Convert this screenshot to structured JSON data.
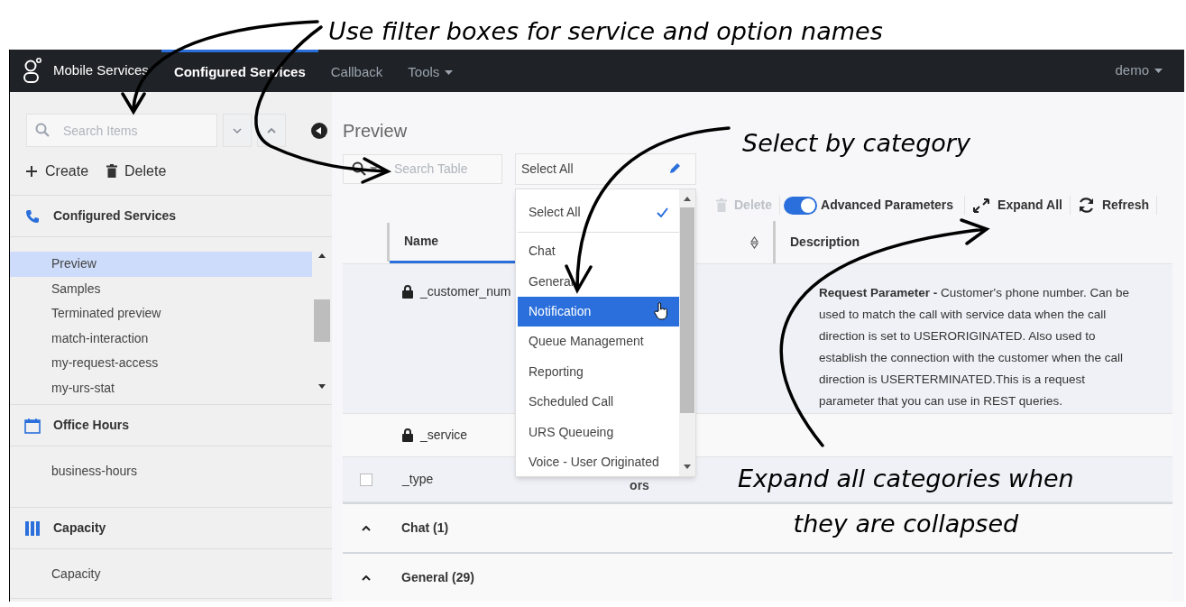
{
  "annotations": [
    {
      "lines": [
        "Use filter boxes for service and option names"
      ]
    },
    {
      "lines": [
        "Select by category"
      ]
    },
    {
      "lines": [
        "Expand all categories when",
        "they are collapsed"
      ]
    }
  ],
  "nav": {
    "brand": "Mobile Services",
    "items": [
      {
        "label": "Configured Services",
        "selected": true,
        "menu": false
      },
      {
        "label": "Callback",
        "selected": false,
        "menu": false
      },
      {
        "label": "Tools",
        "selected": false,
        "menu": true
      }
    ],
    "user": "demo"
  },
  "sidebar": {
    "search": {
      "placeholder": "Search Items"
    },
    "actions": [
      {
        "kind": "create",
        "label": "Create"
      },
      {
        "kind": "delete",
        "label": "Delete"
      }
    ],
    "sections": [
      {
        "title": "Configured Services",
        "items": [
          {
            "label": "Preview",
            "selected": true
          },
          {
            "label": "Samples",
            "selected": false
          },
          {
            "label": "Terminated preview",
            "selected": false
          },
          {
            "label": "match-interaction",
            "selected": false
          },
          {
            "label": "my-request-access",
            "selected": false
          },
          {
            "label": "my-urs-stat",
            "selected": false
          }
        ]
      },
      {
        "title": "Office Hours",
        "items": [
          {
            "label": "business-hours",
            "selected": false
          }
        ]
      },
      {
        "title": "Capacity",
        "items": [
          {
            "label": "Capacity",
            "selected": false
          }
        ]
      }
    ]
  },
  "main": {
    "title": "Preview",
    "table_search": {
      "placeholder": "Search Table"
    },
    "category_select": {
      "value": "Select All",
      "options": [
        {
          "label": "Select All",
          "selected": true,
          "highlighted": false
        },
        {
          "label": "Chat",
          "selected": false,
          "highlighted": false
        },
        {
          "label": "General",
          "selected": false,
          "highlighted": false
        },
        {
          "label": "Notification",
          "selected": false,
          "highlighted": true
        },
        {
          "label": "Queue Management",
          "selected": false,
          "highlighted": false
        },
        {
          "label": "Reporting",
          "selected": false,
          "highlighted": false
        },
        {
          "label": "Scheduled Call",
          "selected": false,
          "highlighted": false
        },
        {
          "label": "URS Queueing",
          "selected": false,
          "highlighted": false
        },
        {
          "label": "Voice - User Originated",
          "selected": false,
          "highlighted": false
        }
      ]
    },
    "toolbar": [
      {
        "kind": "delete",
        "label": "Delete",
        "disabled": true
      },
      {
        "kind": "toggle",
        "label": "Advanced Parameters",
        "on": true
      },
      {
        "kind": "expand",
        "label": "Expand All",
        "disabled": false
      },
      {
        "kind": "refresh",
        "label": "Refresh",
        "disabled": false
      }
    ],
    "table": {
      "columns": [
        {
          "label": "Name",
          "sorted": true
        },
        {
          "sorted": false
        },
        {
          "label": "Description",
          "sorted": false
        }
      ],
      "rows": [
        {
          "kind": "locked",
          "name": "_customer_num",
          "description": "**Request Parameter -** Customer's phone number. Can be used to match the call with service data when the call direction is set to USERORIGINATED. Also used to establish the connection with the customer when the call direction is USERTERMINATED.This is a request parameter that you can use in REST queries."
        },
        {
          "kind": "locked",
          "name": "_service"
        },
        {
          "kind": "checkbox",
          "checked": false,
          "name": "_type",
          "column_3": "ors"
        }
      ],
      "groups": [
        {
          "label": "Chat (1)",
          "expanded": true
        },
        {
          "label": "General (29)",
          "expanded": true
        }
      ]
    }
  }
}
